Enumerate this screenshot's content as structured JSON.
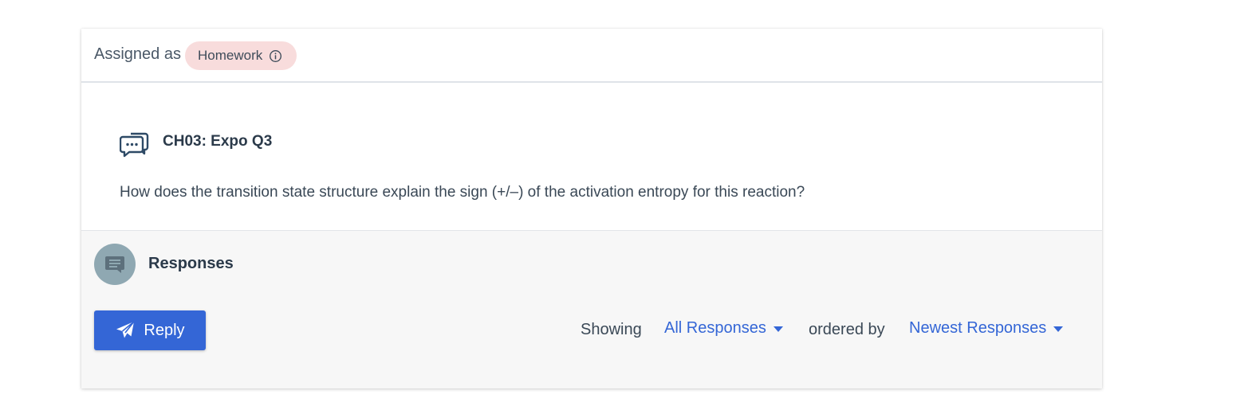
{
  "assignment": {
    "label": "Assigned as",
    "badge": "Homework",
    "badge_color": "#f8dcdc"
  },
  "question": {
    "icon": "discussion-bubbles-icon",
    "title": "CH03: Expo Q3",
    "prompt": "How does the transition state structure explain the sign (+/–) of the activation entropy for this reaction?"
  },
  "responses": {
    "icon": "comment-icon",
    "title": "Responses",
    "reply_label": "Reply",
    "showing_label": "Showing",
    "showing_value": "All Responses",
    "ordered_label": "ordered by",
    "ordered_value": "Newest Responses"
  },
  "colors": {
    "accent": "#3466d6",
    "avatar": "#8fa8b2",
    "footer_bg": "#f7f7f7"
  }
}
